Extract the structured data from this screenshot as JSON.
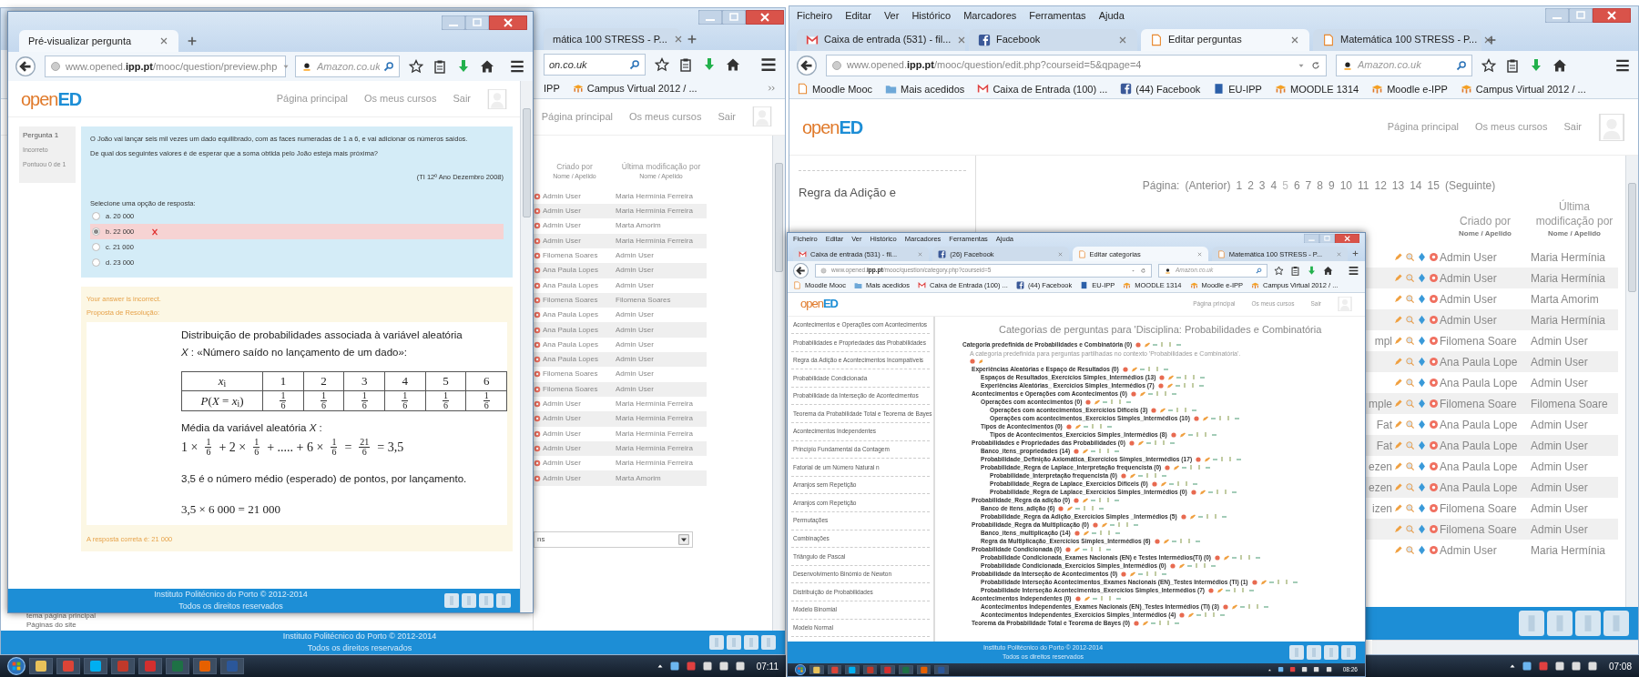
{
  "left_screen": {
    "back_window": {
      "tab": {
        "label": "mática 100 STRESS - P...",
        "selected": false
      },
      "search": {
        "value": "on.co.uk"
      },
      "bookmarks": [
        {
          "label": "IPP",
          "kind": "plain"
        },
        {
          "label": "Campus Virtual 2012 / ...",
          "kind": "moodle"
        }
      ],
      "nav": [
        "Página principal",
        "Os meus cursos",
        "Sair"
      ],
      "columns": [
        {
          "label": "Criado por",
          "sublabel": "Nome / Apelido"
        },
        {
          "label": "Última modificação por",
          "sublabel": "Nome / Apelido"
        }
      ],
      "rows": [
        {
          "created": "Admin User",
          "modified": "Maria Hermínia Ferreira"
        },
        {
          "created": "Admin User",
          "modified": "Maria Hermínia Ferreira"
        },
        {
          "created": "Admin User",
          "modified": "Marta Amorim"
        },
        {
          "created": "Admin User",
          "modified": "Maria Hermínia Ferreira"
        },
        {
          "created": "Filomena Soares",
          "modified": "Admin User"
        },
        {
          "created": "Ana Paula Lopes",
          "modified": "Admin User"
        },
        {
          "created": "Ana Paula Lopes",
          "modified": "Admin User"
        },
        {
          "created": "Filomena Soares",
          "modified": "Filomena Soares"
        },
        {
          "created": "Ana Paula Lopes",
          "modified": "Admin User"
        },
        {
          "created": "Ana Paula Lopes",
          "modified": "Admin User"
        },
        {
          "created": "Ana Paula Lopes",
          "modified": "Admin User"
        },
        {
          "created": "Ana Paula Lopes",
          "modified": "Admin User"
        },
        {
          "created": "Filomena Soares",
          "modified": "Admin User"
        },
        {
          "created": "Filomena Soares",
          "modified": "Admin User"
        },
        {
          "created": "Admin User",
          "modified": "Maria Hermínia Ferreira"
        },
        {
          "created": "Admin User",
          "modified": "Maria Hermínia Ferreira"
        },
        {
          "created": "Admin User",
          "modified": "Maria Hermínia Ferreira"
        },
        {
          "created": "Admin User",
          "modified": "Maria Hermínia Ferreira"
        },
        {
          "created": "Admin User",
          "modified": "Maria Hermínia Ferreira"
        },
        {
          "created": "Admin User",
          "modified": "Marta Amorim"
        }
      ],
      "select": {
        "value": "ns"
      },
      "side_links": [
        "tema página principal",
        "Páginas do site"
      ],
      "footer": [
        "Instituto Politécnico do Porto © 2012-2014",
        "Todos os direitos reservados"
      ]
    },
    "front_window": {
      "tab": {
        "label": "Pré-visualizar pergunta",
        "selected": true
      },
      "address": "www.opened.**ipp.pt**/mooc/question/preview.php",
      "search": {
        "placeholder": "Amazon.co.uk"
      },
      "logo": {
        "prefix": "open",
        "suffix": "ED"
      },
      "nav": [
        "Página principal",
        "Os meus cursos",
        "Sair"
      ],
      "info": [
        "Pergunta 1",
        "Incorreto",
        "Pontuou 0 de 1"
      ],
      "question": [
        "O João vai lançar seis mil vezes um dado equilibrado, com as faces numeradas de 1 a 6, e vai adicionar os números saídos.",
        "De qual dos seguintes valores é de esperar que a soma obtida pelo João esteja mais próxima?"
      ],
      "source": "(TI 12º Ano Dezembro 2008)",
      "prompt": "Selecione uma opção de resposta:",
      "options": [
        {
          "label": "a. 20 000",
          "selected": false,
          "incorrect": false
        },
        {
          "label": "b. 22 000",
          "selected": true,
          "incorrect": true
        },
        {
          "label": "c. 21 000",
          "selected": false,
          "incorrect": false
        },
        {
          "label": "d. 23 000",
          "selected": false,
          "incorrect": false
        }
      ],
      "feedback": "Your answer is incorrect.",
      "resolution_title": "Proposta de Resolução:",
      "resolution": {
        "intro": "Distribuição de probabilidades associada à variável aleatória",
        "variable_line": "*X* : «Número saído no lançamento de um dado»:",
        "table": {
          "header": "*x*$_{i}$",
          "values": [
            "1",
            "2",
            "3",
            "4",
            "5",
            "6"
          ],
          "row_label": "*P*(*X* = *x*$_{i}$)",
          "probabilities": [
            {
              "numerator": "1",
              "denominator": "6"
            },
            {
              "numerator": "1",
              "denominator": "6"
            },
            {
              "numerator": "1",
              "denominator": "6"
            },
            {
              "numerator": "1",
              "denominator": "6"
            },
            {
              "numerator": "1",
              "denominator": "6"
            },
            {
              "numerator": "1",
              "denominator": "6"
            }
          ]
        },
        "mean_label": "Média da variável aleatória  *X* :",
        "mean_formula": [
          {
            "kind": "text",
            "text": "1 ×"
          },
          {
            "kind": "fraction",
            "numerator": "1",
            "denominator": "6"
          },
          {
            "kind": "text",
            "text": "+ 2 ×"
          },
          {
            "kind": "fraction",
            "numerator": "1",
            "denominator": "6"
          },
          {
            "kind": "text",
            "text": "+ ..... + 6 ×"
          },
          {
            "kind": "fraction",
            "numerator": "1",
            "denominator": "6"
          },
          {
            "kind": "text",
            "text": "="
          },
          {
            "kind": "fraction",
            "numerator": "21",
            "denominator": "6"
          },
          {
            "kind": "text",
            "text": "= 3,5"
          }
        ],
        "conclusion": "3,5  é o número médio (esperado) de pontos, por lançamento.",
        "final": "3,5 × 6 000 = 21 000"
      },
      "correct_answer": "A resposta correta é: 21 000",
      "footer": [
        "Instituto Politécnico do Porto © 2012-2014",
        "Todos os direitos reservados"
      ]
    },
    "taskbar": {
      "clock": "07:11"
    }
  },
  "right_screen": {
    "back_window": {
      "menu": [
        "Ficheiro",
        "Editar",
        "Ver",
        "Histórico",
        "Marcadores",
        "Ferramentas",
        "Ajuda"
      ],
      "tabs": [
        {
          "label": "Caixa de entrada (531) - fil...",
          "kind": "mail",
          "selected": false
        },
        {
          "label": "Facebook",
          "kind": "facebook",
          "selected": false
        },
        {
          "label": "Editar perguntas",
          "kind": "page",
          "selected": true
        },
        {
          "label": "Matemática 100 STRESS - P...",
          "kind": "page",
          "selected": false
        }
      ],
      "address": "www.opened.**ipp.pt**/mooc/question/edit.php?courseid=5&qpage=4",
      "search": {
        "placeholder": "Amazon.co.uk"
      },
      "bookmarks": [
        {
          "label": "Moodle Mooc",
          "kind": "page"
        },
        {
          "label": "Mais acedidos",
          "kind": "folder"
        },
        {
          "label": "Caixa de Entrada (100) ...",
          "kind": "mail"
        },
        {
          "label": "(44) Facebook",
          "kind": "facebook"
        },
        {
          "label": "EU-IPP",
          "kind": "book"
        },
        {
          "label": "MOODLE 1314",
          "kind": "moodle"
        },
        {
          "label": "Moodle e-IPP",
          "kind": "moodle"
        },
        {
          "label": "Campus Virtual 2012 / ...",
          "kind": "moodle"
        }
      ],
      "logo": {
        "prefix": "open",
        "suffix": "ED"
      },
      "nav": [
        "Página principal",
        "Os meus cursos",
        "Sair"
      ],
      "sidebar_item": "Regra da Adição e",
      "pagination": {
        "label": "Página:",
        "previous": "(Anterior)",
        "pages": [
          {
            "label": "1",
            "selected": false
          },
          {
            "label": "2",
            "selected": false
          },
          {
            "label": "3",
            "selected": false
          },
          {
            "label": "4",
            "selected": false
          },
          {
            "label": "5",
            "selected": true
          },
          {
            "label": "6",
            "selected": false
          },
          {
            "label": "7",
            "selected": false
          },
          {
            "label": "8",
            "selected": false
          },
          {
            "label": "9",
            "selected": false
          },
          {
            "label": "10",
            "selected": false
          },
          {
            "label": "11",
            "selected": false
          },
          {
            "label": "12",
            "selected": false
          },
          {
            "label": "13",
            "selected": false
          },
          {
            "label": "14",
            "selected": false
          },
          {
            "label": "15",
            "selected": false
          }
        ],
        "next": "(Seguinte)"
      },
      "columns": [
        {
          "label": "Criado por",
          "sublabel": "Nome / Apelido"
        },
        {
          "label": "Última modificação por",
          "sublabel": "Nome / Apelido"
        }
      ],
      "rows": [
        {
          "created": "Admin User",
          "modified": "Maria Hermínia"
        },
        {
          "created": "Admin User",
          "modified": "Maria Hermínia"
        },
        {
          "created": "Admin User",
          "modified": "Marta Amorim"
        },
        {
          "created": "Admin User",
          "modified": "Maria Hermínia"
        },
        {
          "fragment": "mpl",
          "created": "Filomena Soare",
          "modified": "Admin User"
        },
        {
          "created": "Ana Paula Lope",
          "modified": "Admin User"
        },
        {
          "created": "Ana Paula Lope",
          "modified": "Admin User"
        },
        {
          "fragment": "mple",
          "created": "Filomena Soare",
          "modified": "Filomena Soare"
        },
        {
          "fragment": "Fat",
          "created": "Ana Paula Lope",
          "modified": "Admin User"
        },
        {
          "fragment": "Fat",
          "created": "Ana Paula Lope",
          "modified": "Admin User"
        },
        {
          "fragment": "ezen",
          "created": "Ana Paula Lope",
          "modified": "Admin User"
        },
        {
          "fragment": "ezen",
          "created": "Ana Paula Lope",
          "modified": "Admin User"
        },
        {
          "fragment": "izen",
          "created": "Filomena Soare",
          "modified": "Admin User"
        },
        {
          "created": "Filomena Soare",
          "modified": "Admin User"
        },
        {
          "created": "Admin User",
          "modified": "Maria Hermínia"
        }
      ],
      "taskbar": {
        "clock": "07:08"
      }
    },
    "front_window": {
      "menu": [
        "Ficheiro",
        "Editar",
        "Ver",
        "Histórico",
        "Marcadores",
        "Ferramentas",
        "Ajuda"
      ],
      "tabs": [
        {
          "label": "Caixa de entrada (531) - fil...",
          "kind": "mail",
          "selected": false
        },
        {
          "label": "(26) Facebook",
          "kind": "facebook",
          "selected": false
        },
        {
          "label": "Editar categorias",
          "kind": "page",
          "selected": true
        },
        {
          "label": "Matemática 100 STRESS - P...",
          "kind": "page",
          "selected": false
        }
      ],
      "address": "www.opened.**ipp.pt**/mooc/question/category.php?courseid=5",
      "search": {
        "placeholder": "Amazon.co.uk"
      },
      "bookmarks": [
        {
          "label": "Moodle Mooc",
          "kind": "page"
        },
        {
          "label": "Mais acedidos",
          "kind": "folder"
        },
        {
          "label": "Caixa de Entrada (100) ...",
          "kind": "mail"
        },
        {
          "label": "(44) Facebook",
          "kind": "facebook"
        },
        {
          "label": "EU-IPP",
          "kind": "book"
        },
        {
          "label": "MOODLE 1314",
          "kind": "moodle"
        },
        {
          "label": "Moodle e-IPP",
          "kind": "moodle"
        },
        {
          "label": "Campus Virtual 2012 / ...",
          "kind": "moodle"
        }
      ],
      "logo": {
        "prefix": "open",
        "suffix": "ED"
      },
      "nav": [
        "Página principal",
        "Os meus cursos",
        "Sair"
      ],
      "sidebar": [
        "Acontecimentos e Operações com Acontecimentos",
        "Probabilidades e Propriedades das Probabilidades",
        "Regra da Adição e Acontecimentos Incompatíveis",
        "Probabilidade Condicionada",
        "Probabilidade da Interseção de Acontecimentos",
        "Teorema da Probabilidade Total e Teorema de Bayes",
        "Acontecimentos Independentes",
        "Princípio Fundamental da Contagem",
        "Fatorial de um Número Natural n",
        "Arranjos sem Repetição",
        "Arranjos com Repetição",
        "Permutações",
        "Combinações",
        "Triângulo de Pascal",
        "Desenvolvimento Binómio de Newton",
        "Distribuição de Probabilidades",
        "Modelo Binomial",
        "Modelo Normal"
      ],
      "heading": "Categorias de perguntas para 'Disciplina: Probabilidades e Combinatória",
      "categories": [
        {
          "label": "Categoria predefinida de Probabilidades e Combinatória (0)",
          "description": "A categoria predefinida para perguntas partilhadas no contexto 'Probabilidades e Combinatória'.",
          "children": [
            {
              "label": "Experiências Aleatórias e Espaço de Resultados (0)",
              "children": [
                {
                  "label": "Espaços de Resultados_Exercícios Simples_Intermédios (13)"
                },
                {
                  "label": "Experiências Aleatórias_ Exercícios Simples_Intermédios (7)"
                }
              ]
            },
            {
              "label": "Acontecimentos e Operações com Acontecimentos (0)",
              "children": [
                {
                  "label": "Operações com acontecimentos (0)",
                  "children": [
                    {
                      "label": "Operações com acontecimentos_Exercícios Difíceis (3)"
                    },
                    {
                      "label": "Operações com acontecimentos_Exercícios Simples_Intermédios (10)"
                    }
                  ]
                },
                {
                  "label": "Tipos de Acontecimentos (0)",
                  "children": [
                    {
                      "label": "Tipos de Acontecimentos_Exercícios Simples_Intermédios (8)"
                    }
                  ]
                }
              ]
            },
            {
              "label": "Probabilidades e Propriedades das Probabilidades (0)",
              "children": [
                {
                  "label": "Banco_itens_propriedades (14)"
                },
                {
                  "label": "Probabilidade_Definição Axiomática_Exercícios Simples_Intermédios (17)"
                },
                {
                  "label": "Probabilidade_Regra de Laplace_Interpretação frequencista (0)",
                  "children": [
                    {
                      "label": "Probabilidade_Interpretação frequencista (0)"
                    },
                    {
                      "label": "Probabilidade_Regra de Laplace_Exercícios Difíceis (0)"
                    },
                    {
                      "label": "Probabilidade_Regra de Laplace_Exercícios Simples_Intermédios (0)"
                    }
                  ]
                }
              ]
            },
            {
              "label": "Probabilidade_Regra da adição (0)",
              "children": [
                {
                  "label": "Banco de itens_adição (6)"
                },
                {
                  "label": "Probabilidade_Regra da Adição_Exercícios Simples _Intermédios (5)"
                }
              ]
            },
            {
              "label": "Probabilidade_Regra da Multiplicação (0)",
              "children": [
                {
                  "label": "Banco_itens_multiplicação (14)"
                },
                {
                  "label": "Regra da Multiplicação_Exercícios Simples_Intermédios (6)"
                }
              ]
            },
            {
              "label": "Probabilidade Condicionada (0)",
              "children": [
                {
                  "label": "Probabilidade Condicionada_Exames Nacionais (EN) e Testes Intermédios(TI) (0)"
                },
                {
                  "label": "Probabilidade Condicionada_Exercícios Simples_Intermédios (0)"
                }
              ]
            },
            {
              "label": "Probabilidade da Interseção de Acontecimentos (0)",
              "children": [
                {
                  "label": "Probabilidade Interseção Acontecimentos_Exames Nacionais (EN)_Testes Intermédios (TI) (1)"
                },
                {
                  "label": "Probabilidade Interseção Acontecimentos_Exercícios Simples_Intermédios (7)"
                }
              ]
            },
            {
              "label": "Acontecimentos Independentes (0)",
              "children": [
                {
                  "label": "Acontecimentos Independentes_Exames Nacionais (EN)_Testes Intermédios (TI) (3)"
                },
                {
                  "label": "Acontecimentos Independentes_Exercícios Simples_Intermédios (4)"
                }
              ]
            },
            {
              "label": "Teorema da Probabilidade Total e Teorema de Bayes (0)"
            }
          ]
        }
      ],
      "footer": [
        "Instituto Politécnico do Porto © 2012-2014",
        "Todos os direitos reservados"
      ],
      "taskbar": {
        "clock": "08:26"
      }
    }
  }
}
